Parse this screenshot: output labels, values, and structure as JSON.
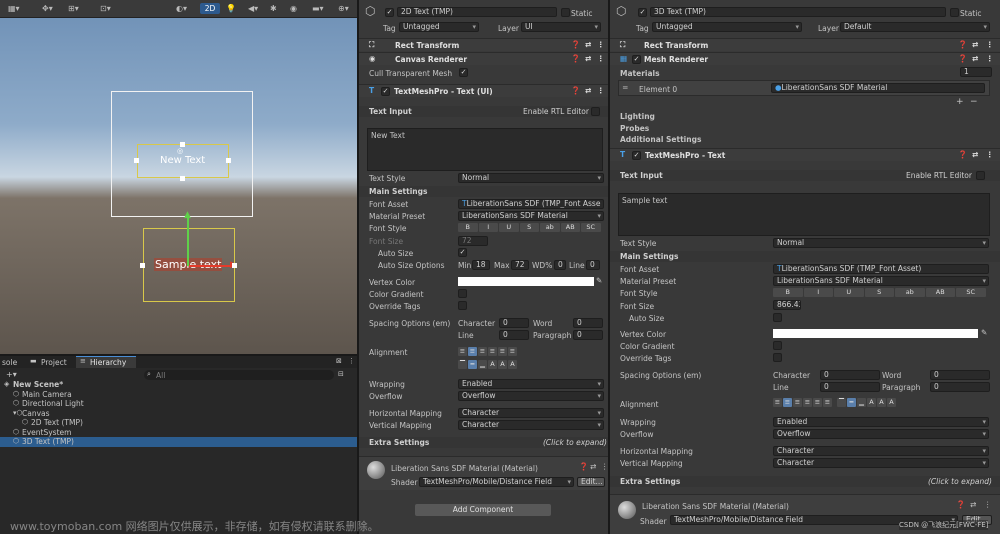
{
  "scene_toolbar": {
    "mode_2d": "2D"
  },
  "scene_view": {
    "box_text_upper": "New Text",
    "box_text_lower": "Sample text"
  },
  "tabs": {
    "console": "sole",
    "project": "Project",
    "hierarchy": "Hierarchy"
  },
  "hierarchy": {
    "search_placeholder": "All",
    "items": [
      {
        "label": "New Scene*",
        "indent": 0
      },
      {
        "label": "Main Camera",
        "indent": 1
      },
      {
        "label": "Directional Light",
        "indent": 1
      },
      {
        "label": "Canvas",
        "indent": 1
      },
      {
        "label": "2D Text (TMP)",
        "indent": 2
      },
      {
        "label": "EventSystem",
        "indent": 1
      },
      {
        "label": "3D Text (TMP)",
        "indent": 1
      }
    ]
  },
  "inspector_left": {
    "name": "2D Text (TMP)",
    "static": "Static",
    "tag_label": "Tag",
    "tag_value": "Untagged",
    "layer_label": "Layer",
    "layer_value": "UI",
    "rect_transform": "Rect Transform",
    "canvas_renderer": "Canvas Renderer",
    "cull_transparent": "Cull Transparent Mesh",
    "tmp_header": "TextMeshPro - Text (UI)",
    "text_input": "Text Input",
    "enable_rtl": "Enable RTL Editor",
    "text_value": "New Text",
    "text_style_label": "Text Style",
    "text_style_value": "Normal",
    "main_settings": "Main Settings",
    "font_asset_label": "Font Asset",
    "font_asset_value": "LiberationSans SDF (TMP_Font Asse",
    "material_preset_label": "Material Preset",
    "material_preset_value": "LiberationSans SDF Material",
    "font_style_label": "Font Style",
    "font_style_buttons": [
      "B",
      "I",
      "U",
      "S",
      "ab",
      "AB",
      "SC"
    ],
    "font_size_label": "Font Size",
    "font_size_value": "72",
    "auto_size_label": "Auto Size",
    "auto_size_options_label": "Auto Size Options",
    "min_label": "Min",
    "min_value": "18",
    "max_label": "Max",
    "max_value": "72",
    "wd_label": "WD%",
    "wd_value": "0",
    "line_label": "Line",
    "line_value": "0",
    "vertex_color_label": "Vertex Color",
    "color_gradient_label": "Color Gradient",
    "override_tags_label": "Override Tags",
    "spacing_label": "Spacing Options (em)",
    "character_label": "Character",
    "character_value": "0",
    "word_label": "Word",
    "word_value": "0",
    "line_sp_label": "Line",
    "line_sp_value": "0",
    "paragraph_label": "Paragraph",
    "paragraph_value": "0",
    "alignment_label": "Alignment",
    "wrapping_label": "Wrapping",
    "wrapping_value": "Enabled",
    "overflow_label": "Overflow",
    "overflow_value": "Overflow",
    "hmap_label": "Horizontal Mapping",
    "hmap_value": "Character",
    "vmap_label": "Vertical Mapping",
    "vmap_value": "Character",
    "extra_settings": "Extra Settings",
    "click_expand": "(Click to expand)",
    "material_name": "Liberation Sans SDF Material (Material)",
    "shader_label": "Shader",
    "shader_value": "TextMeshPro/Mobile/Distance Field",
    "edit_button": "Edit...",
    "add_component": "Add Component"
  },
  "inspector_right": {
    "name": "3D Text (TMP)",
    "static": "Static",
    "tag_label": "Tag",
    "tag_value": "Untagged",
    "layer_label": "Layer",
    "layer_value": "Default",
    "rect_transform": "Rect Transform",
    "mesh_renderer": "Mesh Renderer",
    "materials_label": "Materials",
    "materials_count": "1",
    "element0_label": "Element 0",
    "element0_value": "LiberationSans SDF Material",
    "lighting": "Lighting",
    "probes": "Probes",
    "additional_settings": "Additional Settings",
    "tmp_header": "TextMeshPro - Text",
    "text_input": "Text Input",
    "enable_rtl": "Enable RTL Editor",
    "text_value": "Sample text",
    "text_style_label": "Text Style",
    "text_style_value": "Normal",
    "main_settings": "Main Settings",
    "font_asset_label": "Font Asset",
    "font_asset_value": "LiberationSans SDF (TMP_Font Asset)",
    "material_preset_label": "Material Preset",
    "material_preset_value": "LiberationSans SDF Material",
    "font_style_label": "Font Style",
    "font_style_buttons": [
      "B",
      "I",
      "U",
      "S",
      "ab",
      "AB",
      "SC"
    ],
    "font_size_label": "Font Size",
    "font_size_value": "866.43",
    "auto_size_label": "Auto Size",
    "vertex_color_label": "Vertex Color",
    "color_gradient_label": "Color Gradient",
    "override_tags_label": "Override Tags",
    "spacing_label": "Spacing Options (em)",
    "character_label": "Character",
    "character_value": "0",
    "word_label": "Word",
    "word_value": "0",
    "line_sp_label": "Line",
    "line_sp_value": "0",
    "paragraph_label": "Paragraph",
    "paragraph_value": "0",
    "alignment_label": "Alignment",
    "wrapping_label": "Wrapping",
    "wrapping_value": "Enabled",
    "overflow_label": "Overflow",
    "overflow_value": "Overflow",
    "hmap_label": "Horizontal Mapping",
    "hmap_value": "Character",
    "vmap_label": "Vertical Mapping",
    "vmap_value": "Character",
    "extra_settings": "Extra Settings",
    "click_expand": "(Click to expand)",
    "material_name": "Liberation Sans SDF Material (Material)",
    "shader_label": "Shader",
    "shader_value": "TextMeshPro/Mobile/Distance Field",
    "edit_button": "Edit..."
  },
  "watermark": {
    "left": "www.toymoban.com 网络图片仅供展示，非存储，如有侵权请联系删除。",
    "right": "CSDN @飞浪纪元[FWC-FE]"
  }
}
